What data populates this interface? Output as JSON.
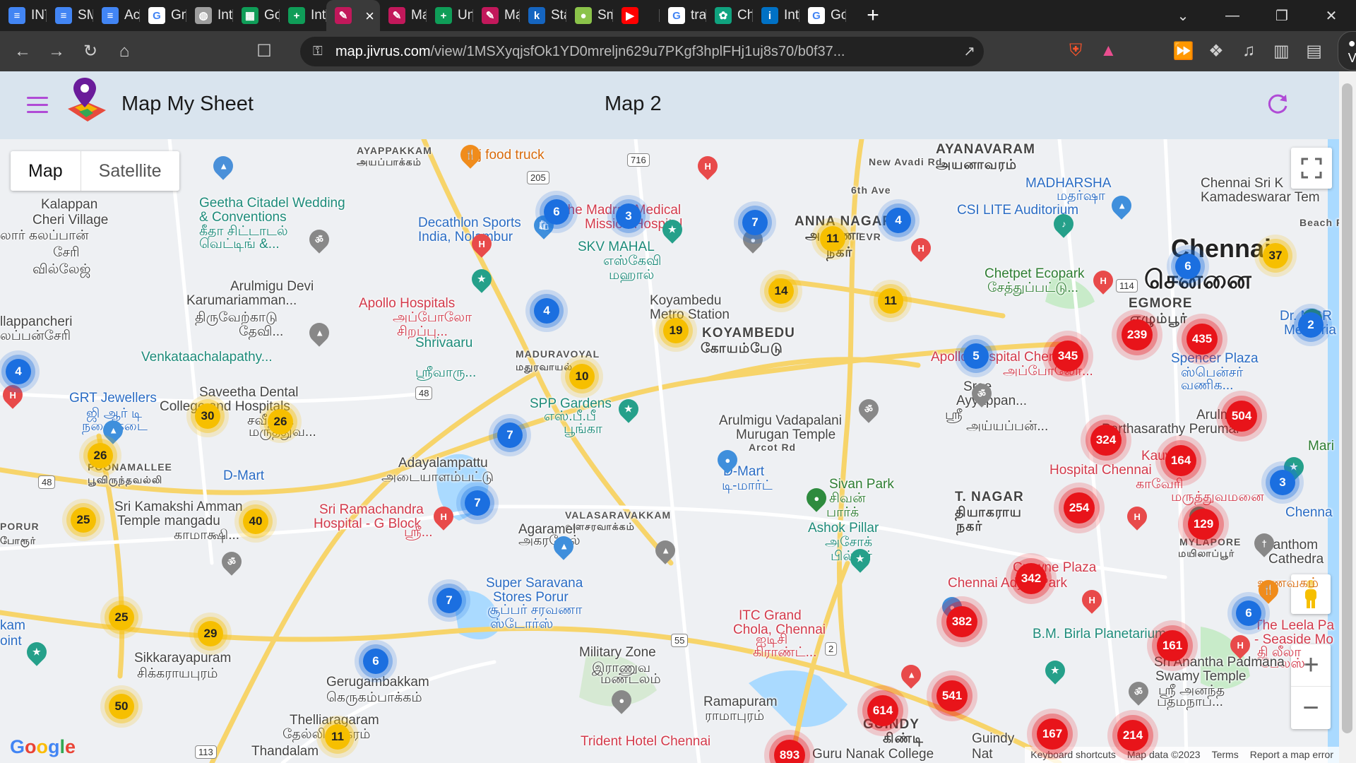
{
  "browser": {
    "tabs": [
      {
        "label": "INT",
        "icon": "docs-icon",
        "color": "#4285f4",
        "glyph": "≡"
      },
      {
        "label": "SM",
        "icon": "docs-icon",
        "color": "#4285f4",
        "glyph": "≡"
      },
      {
        "label": "Acc",
        "icon": "docs-icon",
        "color": "#4285f4",
        "glyph": "≡"
      },
      {
        "label": "Gm",
        "icon": "google-icon",
        "color": "#ffffff",
        "glyph": "G"
      },
      {
        "label": "Inte",
        "icon": "globe-icon",
        "color": "#9e9e9e",
        "glyph": "◍"
      },
      {
        "label": "Goc",
        "icon": "sheets-icon",
        "color": "#0f9d58",
        "glyph": "▦"
      },
      {
        "label": "Inte",
        "icon": "sheets-plus-icon",
        "color": "#0f9d58",
        "glyph": "+"
      },
      {
        "label": "",
        "icon": "map-my-sheet-icon",
        "color": "#c2185b",
        "glyph": "✎",
        "active": true
      },
      {
        "label": "Maj",
        "icon": "map-my-sheet-icon",
        "color": "#c2185b",
        "glyph": "✎"
      },
      {
        "label": "Unt",
        "icon": "sheets-plus-icon",
        "color": "#0f9d58",
        "glyph": "+"
      },
      {
        "label": "Maj",
        "icon": "map-my-sheet-icon",
        "color": "#c2185b",
        "glyph": "✎"
      },
      {
        "label": "Star",
        "icon": "k-icon",
        "color": "#1565c0",
        "glyph": "k"
      },
      {
        "label": "Sma",
        "icon": "balloon-icon",
        "color": "#8bc34a",
        "glyph": "●"
      },
      {
        "label": "",
        "icon": "youtube-icon",
        "color": "#ff0000",
        "glyph": "▶"
      },
      {
        "label": "traf",
        "icon": "google-icon",
        "color": "#ffffff",
        "glyph": "G"
      },
      {
        "label": "Cha",
        "icon": "chatgpt-icon",
        "color": "#10a37f",
        "glyph": "✿"
      },
      {
        "label": "Inte",
        "icon": "intel-icon",
        "color": "#0071c5",
        "glyph": "i"
      },
      {
        "label": "Goc",
        "icon": "google-icon",
        "color": "#ffffff",
        "glyph": "G"
      }
    ],
    "url_host": "map.jivrus.com",
    "url_path": "/view/1MSXyqjsfOk1YD0mreljn629u7PKgf3hplFHj1uj8s70/b0f37...",
    "vpn_label": "VPN",
    "shield_count": "3"
  },
  "app": {
    "title": "Map My Sheet",
    "map_name": "Map 2",
    "accent": "#b04bd6"
  },
  "map": {
    "type_options": [
      "Map",
      "Satellite"
    ],
    "selected_type": "Map",
    "zoom_in": "+",
    "zoom_out": "−",
    "google_logo": "Google",
    "attribution": [
      "Keyboard shortcuts",
      "Map data ©2023",
      "Terms",
      "Report a map error"
    ],
    "clusters": [
      {
        "count": "6",
        "level": "blue"
      },
      {
        "count": "3",
        "level": "blue"
      },
      {
        "count": "7",
        "level": "blue"
      },
      {
        "count": "4",
        "level": "blue"
      },
      {
        "count": "4",
        "level": "blue"
      },
      {
        "count": "4",
        "level": "blue"
      },
      {
        "count": "7",
        "level": "blue"
      },
      {
        "count": "7",
        "level": "blue"
      },
      {
        "count": "7",
        "level": "blue"
      },
      {
        "count": "6",
        "level": "blue"
      },
      {
        "count": "5",
        "level": "blue"
      },
      {
        "count": "6",
        "level": "blue"
      },
      {
        "count": "2",
        "level": "blue"
      },
      {
        "count": "3",
        "level": "blue"
      },
      {
        "count": "6",
        "level": "blue"
      },
      {
        "count": "11",
        "level": "yellow"
      },
      {
        "count": "14",
        "level": "yellow"
      },
      {
        "count": "11",
        "level": "yellow"
      },
      {
        "count": "19",
        "level": "yellow"
      },
      {
        "count": "10",
        "level": "yellow"
      },
      {
        "count": "30",
        "level": "yellow"
      },
      {
        "count": "26",
        "level": "yellow"
      },
      {
        "count": "26",
        "level": "yellow"
      },
      {
        "count": "25",
        "level": "yellow"
      },
      {
        "count": "40",
        "level": "yellow"
      },
      {
        "count": "25",
        "level": "yellow"
      },
      {
        "count": "29",
        "level": "yellow"
      },
      {
        "count": "50",
        "level": "yellow"
      },
      {
        "count": "11",
        "level": "yellow"
      },
      {
        "count": "37",
        "level": "yellow"
      },
      {
        "count": "239",
        "level": "red"
      },
      {
        "count": "435",
        "level": "red"
      },
      {
        "count": "345",
        "level": "red"
      },
      {
        "count": "504",
        "level": "red"
      },
      {
        "count": "324",
        "level": "red"
      },
      {
        "count": "164",
        "level": "red"
      },
      {
        "count": "254",
        "level": "red"
      },
      {
        "count": "129",
        "level": "red"
      },
      {
        "count": "342",
        "level": "red"
      },
      {
        "count": "382",
        "level": "red"
      },
      {
        "count": "161",
        "level": "red"
      },
      {
        "count": "541",
        "level": "red"
      },
      {
        "count": "614",
        "level": "red"
      },
      {
        "count": "167",
        "level": "red"
      },
      {
        "count": "214",
        "level": "red"
      },
      {
        "count": "893",
        "level": "red"
      }
    ],
    "labels": [
      {
        "text": "AYANAVARAM",
        "cls": "area"
      },
      {
        "text": "அயனாவரம்",
        "cls": "area"
      },
      {
        "text": "AYAPPAKKAM",
        "cls": "small"
      },
      {
        "text": "அயப்பாக்கம்",
        "cls": "small"
      },
      {
        "text": "Aj food truck",
        "cls": "orange"
      },
      {
        "text": "Kalappan",
        "cls": "grey"
      },
      {
        "text": "Cheri Village",
        "cls": "grey"
      },
      {
        "text": "லார் கலப்பான்",
        "cls": "grey"
      },
      {
        "text": "சேரி",
        "cls": "grey"
      },
      {
        "text": "வில்லேஜ்",
        "cls": "grey"
      },
      {
        "text": "Geetha Citadel Wedding",
        "cls": "teal"
      },
      {
        "text": "& Conventions",
        "cls": "teal"
      },
      {
        "text": "கீதா சிட்டாடல்",
        "cls": "teal"
      },
      {
        "text": "வெட்டிங் &...",
        "cls": "teal"
      },
      {
        "text": "Decathlon Sports",
        "cls": "blue"
      },
      {
        "text": "India, Nolambur",
        "cls": "blue"
      },
      {
        "text": "The Madras Medical",
        "cls": "red"
      },
      {
        "text": "Mission Hospital",
        "cls": "red"
      },
      {
        "text": "SKV MAHAL",
        "cls": "teal"
      },
      {
        "text": "எஸ்கேவி",
        "cls": "teal"
      },
      {
        "text": "மஹால்",
        "cls": "teal"
      },
      {
        "text": "ANNA NAGAR",
        "cls": "area"
      },
      {
        "text": "அண்ணா",
        "cls": "area"
      },
      {
        "text": "நகர்",
        "cls": "area"
      },
      {
        "text": "6th Ave",
        "cls": "small"
      },
      {
        "text": "New Avadi Rd",
        "cls": "small"
      },
      {
        "text": "MADHARSHA",
        "cls": "blue"
      },
      {
        "text": "மதர்ஷா",
        "cls": "blue"
      },
      {
        "text": "CSI LITE Auditorium",
        "cls": "blue"
      },
      {
        "text": "Chennai Sri K",
        "cls": "grey"
      },
      {
        "text": "Kamadeswarar Tem",
        "cls": "grey"
      },
      {
        "text": "Chennai",
        "cls": "big"
      },
      {
        "text": "சென்னை",
        "cls": "big"
      },
      {
        "text": "Arulmigu Devi",
        "cls": "grey"
      },
      {
        "text": "Karumariamman...",
        "cls": "grey"
      },
      {
        "text": "திருவேற்காடு",
        "cls": "grey"
      },
      {
        "text": "தேவி...",
        "cls": "grey"
      },
      {
        "text": "Apollo Hospitals",
        "cls": "red"
      },
      {
        "text": "அப்போலோ",
        "cls": "red"
      },
      {
        "text": "சிறப்பு...",
        "cls": "red"
      },
      {
        "text": "Koyambedu",
        "cls": "grey"
      },
      {
        "text": "Metro Station",
        "cls": "grey"
      },
      {
        "text": "KOYAMBEDU",
        "cls": "area"
      },
      {
        "text": "கோயம்பேடு",
        "cls": "area"
      },
      {
        "text": "Chetpet Ecopark",
        "cls": "green"
      },
      {
        "text": "சேத்துப்பட்டு...",
        "cls": "green"
      },
      {
        "text": "EGMORE",
        "cls": "area"
      },
      {
        "text": "எழும்பூர்",
        "cls": "area"
      },
      {
        "text": "Dr. MGR",
        "cls": "blue"
      },
      {
        "text": "Memoria",
        "cls": "blue"
      },
      {
        "text": "llappancheri",
        "cls": "grey"
      },
      {
        "text": "லப்பன்சேரி",
        "cls": "grey"
      },
      {
        "text": "Shrivaaru",
        "cls": "teal"
      },
      {
        "text": "Venkataachalapathy...",
        "cls": "teal"
      },
      {
        "text": "ஸ்ரீவாரு...",
        "cls": "teal"
      },
      {
        "text": "MADURAVOYAL",
        "cls": "small"
      },
      {
        "text": "மதுரவாயல்",
        "cls": "small"
      },
      {
        "text": "Apollo Hospital Chennai",
        "cls": "red"
      },
      {
        "text": "அப்போலோ...",
        "cls": "red"
      },
      {
        "text": "Spencer Plaza",
        "cls": "blue"
      },
      {
        "text": "ஸ்பென்சர்",
        "cls": "blue"
      },
      {
        "text": "வணிக...",
        "cls": "blue"
      },
      {
        "text": "Sree",
        "cls": "grey"
      },
      {
        "text": "Ayyappan...",
        "cls": "grey"
      },
      {
        "text": "ஸ்ரீ",
        "cls": "grey"
      },
      {
        "text": "அய்யப்பன்...",
        "cls": "grey"
      },
      {
        "text": "GRT Jewellers",
        "cls": "blue"
      },
      {
        "text": "ஜி ஆர் டி",
        "cls": "blue"
      },
      {
        "text": "நகை கடை",
        "cls": "blue"
      },
      {
        "text": "Saveetha Dental",
        "cls": "grey"
      },
      {
        "text": "College and Hospitals",
        "cls": "grey"
      },
      {
        "text": "சவீதா...",
        "cls": "grey"
      },
      {
        "text": "மருத்துவ...",
        "cls": "grey"
      },
      {
        "text": "SPP Gardens",
        "cls": "teal"
      },
      {
        "text": "எஸ்.பீ.பீ",
        "cls": "teal"
      },
      {
        "text": "பூங்கா",
        "cls": "teal"
      },
      {
        "text": "Arulmigu Vadapalani",
        "cls": "grey"
      },
      {
        "text": "Murugan Temple",
        "cls": "grey"
      },
      {
        "text": "Arulmigu",
        "cls": "grey"
      },
      {
        "text": "Parthasarathy Perumal",
        "cls": "grey"
      },
      {
        "text": "Mari",
        "cls": "green"
      },
      {
        "text": "Kauvery",
        "cls": "red"
      },
      {
        "text": "Hospital Chennai",
        "cls": "red"
      },
      {
        "text": "காவேரி",
        "cls": "red"
      },
      {
        "text": "மருத்துவமனை",
        "cls": "red"
      },
      {
        "text": "POONAMALLEE",
        "cls": "small"
      },
      {
        "text": "பூவிருந்தவல்லி",
        "cls": "small"
      },
      {
        "text": "D-Mart",
        "cls": "blue"
      },
      {
        "text": "Adayalampattu",
        "cls": "grey"
      },
      {
        "text": "அடையாளம்பட்டு",
        "cls": "grey"
      },
      {
        "text": "D-Mart",
        "cls": "blue"
      },
      {
        "text": "டி-மார்ட்",
        "cls": "blue"
      },
      {
        "text": "Arcot Rd",
        "cls": "small"
      },
      {
        "text": "Sivan Park",
        "cls": "green"
      },
      {
        "text": "சிவன்",
        "cls": "green"
      },
      {
        "text": "பார்க்",
        "cls": "green"
      },
      {
        "text": "T. NAGAR",
        "cls": "area"
      },
      {
        "text": "தியாகராய",
        "cls": "area"
      },
      {
        "text": "நகர்",
        "cls": "area"
      },
      {
        "text": "Chenna",
        "cls": "blue"
      },
      {
        "text": "Sri Kamakshi Amman",
        "cls": "grey"
      },
      {
        "text": "Temple mangadu",
        "cls": "grey"
      },
      {
        "text": "காமாக்ஷி...",
        "cls": "grey"
      },
      {
        "text": "Sri Ramachandra",
        "cls": "red"
      },
      {
        "text": "Hospital - G Block",
        "cls": "red"
      },
      {
        "text": "ஸ்ரீ...",
        "cls": "red"
      },
      {
        "text": "VALASARAVAKKAM",
        "cls": "small"
      },
      {
        "text": "வளசரவாக்கம்",
        "cls": "small"
      },
      {
        "text": "Agaramel",
        "cls": "grey"
      },
      {
        "text": "அகரமேல்",
        "cls": "grey"
      },
      {
        "text": "PORUR",
        "cls": "small"
      },
      {
        "text": "போரூர்",
        "cls": "small"
      },
      {
        "text": "Ashok Pillar",
        "cls": "teal"
      },
      {
        "text": "அசோக்",
        "cls": "teal"
      },
      {
        "text": "பில்லர்",
        "cls": "teal"
      },
      {
        "text": "Santhom",
        "cls": "grey"
      },
      {
        "text": "Cathedra",
        "cls": "grey"
      },
      {
        "text": "MYLAPORE",
        "cls": "small"
      },
      {
        "text": "மயிலாப்பூர்",
        "cls": "small"
      },
      {
        "text": "Crowne Plaza",
        "cls": "red"
      },
      {
        "text": "Chennai Adyar Park",
        "cls": "red"
      },
      {
        "text": "Super Saravana",
        "cls": "blue"
      },
      {
        "text": "Stores Porur",
        "cls": "blue"
      },
      {
        "text": "சூப்பர் சரவணா",
        "cls": "blue"
      },
      {
        "text": "ஸ்டோர்ஸ்",
        "cls": "blue"
      },
      {
        "text": "ITC Grand",
        "cls": "red"
      },
      {
        "text": "Chola, Chennai",
        "cls": "red"
      },
      {
        "text": "ஐடிசி",
        "cls": "red"
      },
      {
        "text": "கிராண்ட்...",
        "cls": "red"
      },
      {
        "text": "The Leela Pa",
        "cls": "red"
      },
      {
        "text": "- Seaside Mo",
        "cls": "red"
      },
      {
        "text": "தி லீலா",
        "cls": "red"
      },
      {
        "text": "பேலஸ்",
        "cls": "red"
      },
      {
        "text": "உணவகம்",
        "cls": "orange"
      },
      {
        "text": "kam",
        "cls": "blue"
      },
      {
        "text": "oint",
        "cls": "blue"
      },
      {
        "text": "Military Zone",
        "cls": "grey"
      },
      {
        "text": "இராணுவ",
        "cls": "grey"
      },
      {
        "text": "மண்டலம்",
        "cls": "grey"
      },
      {
        "text": "B.M. Birla Planetarium",
        "cls": "teal"
      },
      {
        "text": "Sri Anantha Padmana",
        "cls": "grey"
      },
      {
        "text": "Swamy Temple",
        "cls": "grey"
      },
      {
        "text": "ஸ்ரீ அனந்த",
        "cls": "grey"
      },
      {
        "text": "பத்மநாப...",
        "cls": "grey"
      },
      {
        "text": "Sikkarayapuram",
        "cls": "grey"
      },
      {
        "text": "சிக்கராயபுரம்",
        "cls": "grey"
      },
      {
        "text": "Gerugambakkam",
        "cls": "grey"
      },
      {
        "text": "கெருகம்பாக்கம்",
        "cls": "grey"
      },
      {
        "text": "Ramapuram",
        "cls": "grey"
      },
      {
        "text": "ராமாபுரம்",
        "cls": "grey"
      },
      {
        "text": "GUINDY",
        "cls": "area"
      },
      {
        "text": "கிண்டி",
        "cls": "area"
      },
      {
        "text": "Guindy",
        "cls": "grey"
      },
      {
        "text": "Thelliaragaram",
        "cls": "grey"
      },
      {
        "text": "தேல்லியாகரம்",
        "cls": "grey"
      },
      {
        "text": "Trident Hotel Chennai",
        "cls": "red"
      },
      {
        "text": "Guru Nanak College",
        "cls": "grey"
      },
      {
        "text": "Nat",
        "cls": "grey"
      },
      {
        "text": "Thandalam",
        "cls": "grey"
      },
      {
        "text": "Beach Rd",
        "cls": "small"
      },
      {
        "text": "EVR",
        "cls": "small"
      }
    ],
    "road_shields": [
      "716",
      "205",
      "48",
      "48",
      "55",
      "2",
      "114",
      "113"
    ]
  }
}
